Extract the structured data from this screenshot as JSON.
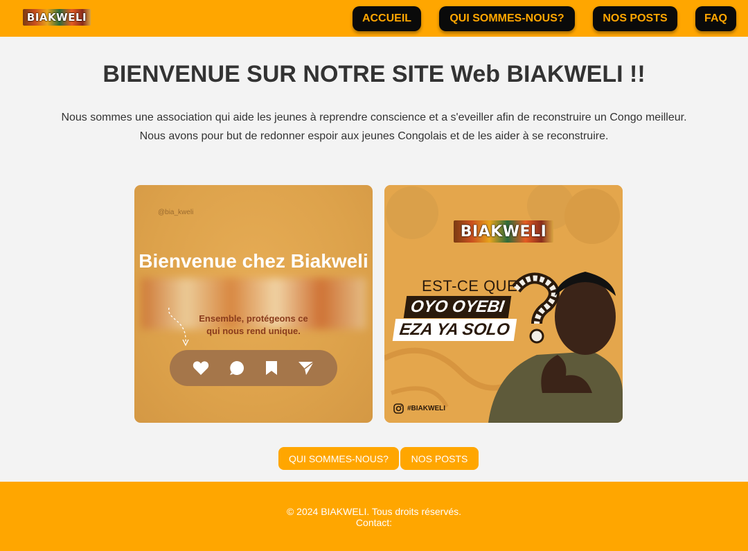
{
  "header": {
    "logo_text": "BIAKWELI",
    "nav": {
      "accueil": "ACCUEIL",
      "qui": "QUI SOMMES-NOUS?",
      "posts": "NOS POSTS",
      "faq": "FAQ"
    }
  },
  "main": {
    "title": "BIENVENUE SUR NOTRE SITE Web BIAKWELI !!",
    "intro_line1": "Nous sommes une association qui aide les jeunes à reprendre conscience et a s'eveiller afin de reconstruire un Congo meilleur.",
    "intro_line2": "Nous avons pour but de redonner espoir aux jeunes Congolais et de les aider à se reconstruire."
  },
  "cards": {
    "card1": {
      "handle": "@bia_kweli",
      "title": "Bienvenue chez Biakweli",
      "subtitle": "Ensemble, protégeons ce qui nous rend unique."
    },
    "card2": {
      "logo_text": "BIAKWELI",
      "question": "EST-CE QUE",
      "line1": "OYO OYEBI",
      "line2": "EZA YA SOLO",
      "hashtag": "#BIAKWELI"
    }
  },
  "cta": {
    "qui": "QUI SOMMES-NOUS?",
    "posts": "NOS POSTS"
  },
  "footer": {
    "copyright": "© 2024 BIAKWELI. Tous droits réservés.",
    "contact": "Contact:"
  },
  "colors": {
    "brand_orange": "#ffa600",
    "nav_bg": "#0a0a0a",
    "page_bg": "#f3f3f3"
  },
  "icons": [
    "heart-icon",
    "comment-icon",
    "bookmark-icon",
    "send-icon",
    "instagram-icon"
  ]
}
